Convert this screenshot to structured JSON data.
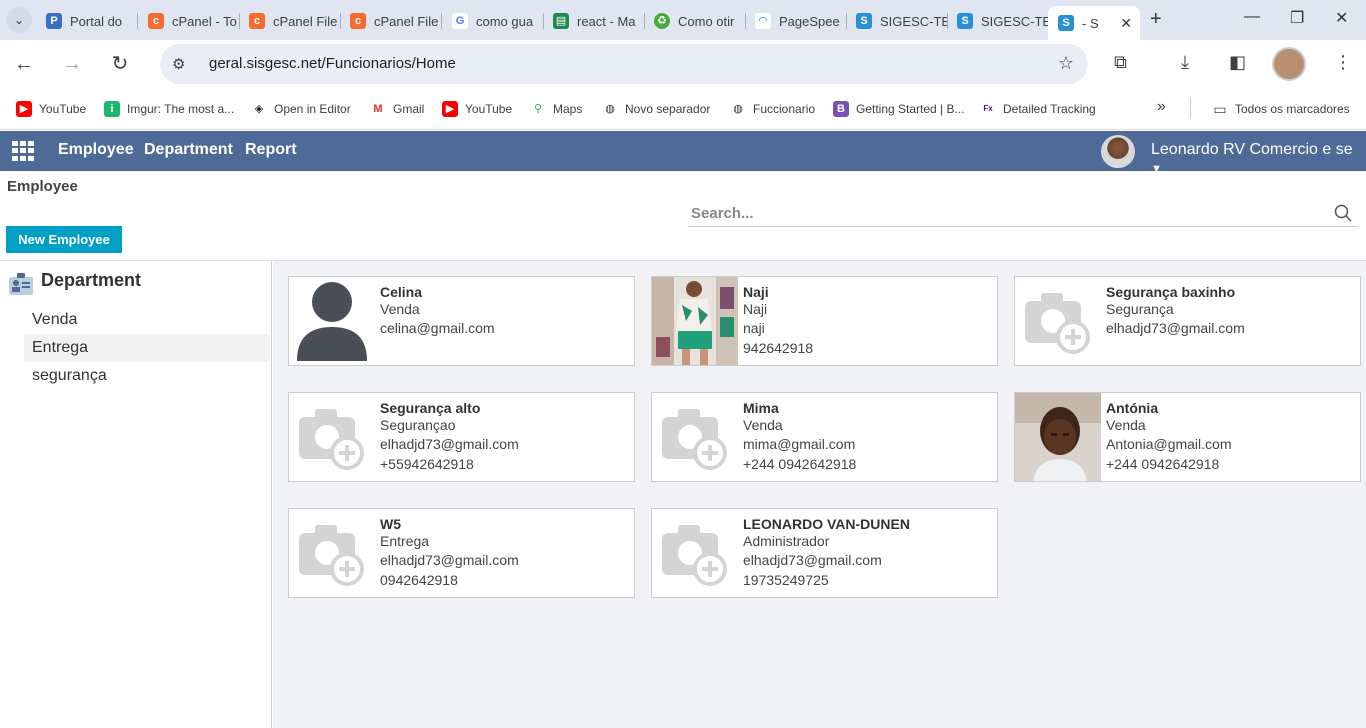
{
  "browser": {
    "tabs": [
      {
        "title": "Portal do",
        "icon": "portal-icon"
      },
      {
        "title": "cPanel - To",
        "icon": "cpanel-icon"
      },
      {
        "title": "cPanel File",
        "icon": "cpanel-icon"
      },
      {
        "title": "cPanel File",
        "icon": "cpanel-icon"
      },
      {
        "title": "como gua",
        "icon": "google-icon"
      },
      {
        "title": "react - Ma",
        "icon": "sheet-icon"
      },
      {
        "title": "Como otir",
        "icon": "recycle-icon"
      },
      {
        "title": "PageSpee",
        "icon": "pagespeed-icon"
      },
      {
        "title": "SIGESC-TE",
        "icon": "sigesc-icon"
      },
      {
        "title": "SIGESC-TE",
        "icon": "sigesc-icon"
      },
      {
        "title": "- S",
        "icon": "sigesc-icon"
      }
    ],
    "url": "geral.sisgesc.net/Funcionarios/Home",
    "bookmarks": [
      {
        "label": "YouTube",
        "icon": "youtube-icon"
      },
      {
        "label": "Imgur: The most a...",
        "icon": "imgur-icon"
      },
      {
        "label": "Open in Editor",
        "icon": "codepen-icon"
      },
      {
        "label": "Gmail",
        "icon": "gmail-icon"
      },
      {
        "label": "YouTube",
        "icon": "youtube-icon"
      },
      {
        "label": "Maps",
        "icon": "maps-icon"
      },
      {
        "label": "Novo separador",
        "icon": "github-icon"
      },
      {
        "label": "Fuccionario",
        "icon": "github-icon"
      },
      {
        "label": "Getting Started | B...",
        "icon": "bootstrap-icon"
      },
      {
        "label": "Detailed Tracking",
        "icon": "fedex-icon"
      }
    ],
    "all_bookmarks": "Todos os marcadores"
  },
  "app": {
    "nav": [
      "Employee",
      "Department",
      "Report"
    ],
    "user": "Leonardo RV Comercio e se",
    "breadcrumb": "Employee",
    "search_placeholder": "Search...",
    "new_button": "New Employee",
    "colors": {
      "navbar": "#4e6a96",
      "primary_button": "#00a0c6"
    }
  },
  "sidebar": {
    "title": "Department",
    "items": [
      "Venda",
      "Entrega",
      "segurança"
    ]
  },
  "employees": [
    {
      "name": "Celina",
      "dept": "Venda",
      "email": "celina@gmail.com",
      "phone": "",
      "photo": "person-silhouette"
    },
    {
      "name": "Naji",
      "dept": "Naji",
      "email": "naji",
      "phone": "942642918",
      "photo": "photo"
    },
    {
      "name": "Segurança baxinho",
      "dept": "Segurança",
      "email": "elhadjd73@gmail.com",
      "phone": "",
      "photo": "camera-placeholder"
    },
    {
      "name": "Segurança alto",
      "dept": "Segurançao",
      "email": "elhadjd73@gmail.com",
      "phone": "+55942642918",
      "photo": "camera-placeholder"
    },
    {
      "name": "Mima",
      "dept": "Venda",
      "email": "mima@gmail.com",
      "phone": "+244 0942642918",
      "photo": "camera-placeholder"
    },
    {
      "name": "Antónia",
      "dept": "Venda",
      "email": "Antonia@gmail.com",
      "phone": "+244 0942642918",
      "photo": "photo"
    },
    {
      "name": "W5",
      "dept": "Entrega",
      "email": "elhadjd73@gmail.com",
      "phone": "0942642918",
      "photo": "camera-placeholder"
    },
    {
      "name": "LEONARDO VAN-DUNEN",
      "dept": "Administrador",
      "email": "elhadjd73@gmail.com",
      "phone": "19735249725",
      "photo": "camera-placeholder"
    }
  ]
}
